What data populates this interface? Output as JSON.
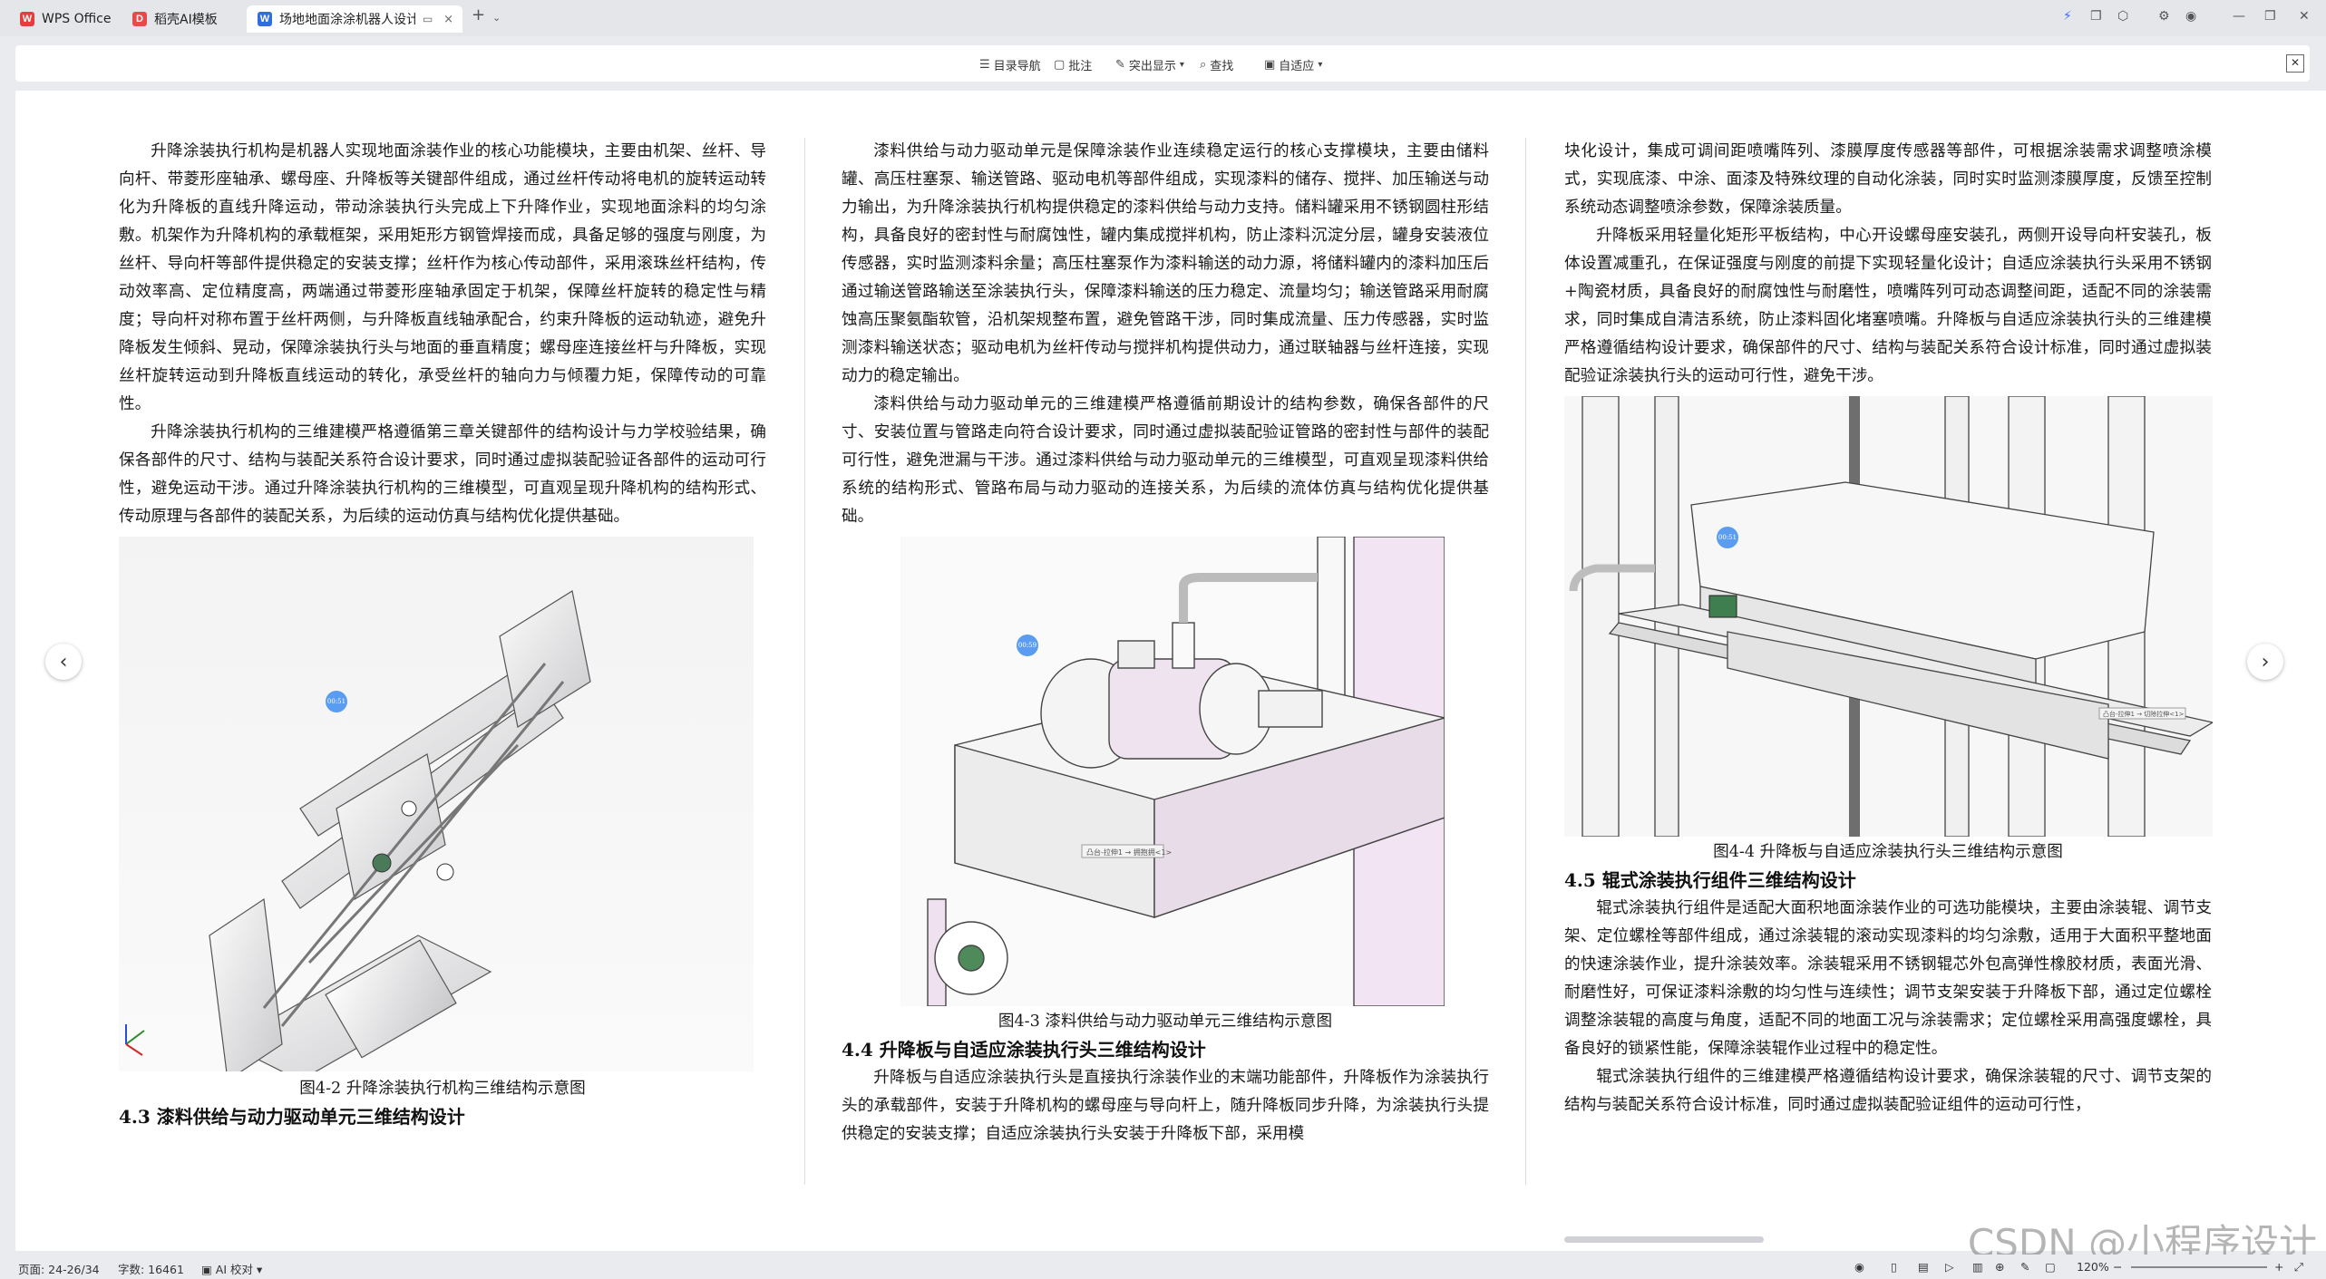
{
  "tabs": [
    {
      "label": "WPS Office",
      "icon": "wps-logo-icon"
    },
    {
      "label": "稻壳AI模板",
      "icon": "docer-logo-icon"
    },
    {
      "label": "场地地面涂涂机器人设计.do",
      "icon": "word-doc-icon"
    }
  ],
  "toolbar": {
    "nav": "目录导航",
    "comment": "批注",
    "highlight": "突出显示",
    "find": "查找",
    "fit": "自适应"
  },
  "doc": {
    "col1": {
      "p1": "升降涂装执行机构是机器人实现地面涂装作业的核心功能模块，主要由机架、丝杆、导向杆、带菱形座轴承、螺母座、升降板等关键部件组成，通过丝杆传动将电机的旋转运动转化为升降板的直线升降运动，带动涂装执行头完成上下升降作业，实现地面涂料的均匀涂敷。机架作为升降机构的承载框架，采用矩形方钢管焊接而成，具备足够的强度与刚度，为丝杆、导向杆等部件提供稳定的安装支撑；丝杆作为核心传动部件，采用滚珠丝杆结构，传动效率高、定位精度高，两端通过带菱形座轴承固定于机架，保障丝杆旋转的稳定性与精度；导向杆对称布置于丝杆两侧，与升降板直线轴承配合，约束升降板的运动轨迹，避免升降板发生倾斜、晃动，保障涂装执行头与地面的垂直精度；螺母座连接丝杆与升降板，实现丝杆旋转运动到升降板直线运动的转化，承受丝杆的轴向力与倾覆力矩，保障传动的可靠性。",
      "p2": "升降涂装执行机构的三维建模严格遵循第三章关键部件的结构设计与力学校验结果，确保各部件的尺寸、结构与装配关系符合设计要求，同时通过虚拟装配验证各部件的运动可行性，避免运动干涉。通过升降涂装执行机构的三维模型，可直观呈现升降机构的结构形式、传动原理与各部件的装配关系，为后续的运动仿真与结构优化提供基础。",
      "fig_caption": "图4-2 升降涂装执行机构三维结构示意图",
      "heading": "4.3 漆料供给与动力驱动单元三维结构设计"
    },
    "col2": {
      "p1": "漆料供给与动力驱动单元是保障涂装作业连续稳定运行的核心支撑模块，主要由储料罐、高压柱塞泵、输送管路、驱动电机等部件组成，实现漆料的储存、搅拌、加压输送与动力输出，为升降涂装执行机构提供稳定的漆料供给与动力支持。储料罐采用不锈钢圆柱形结构，具备良好的密封性与耐腐蚀性，罐内集成搅拌机构，防止漆料沉淀分层，罐身安装液位传感器，实时监测漆料余量；高压柱塞泵作为漆料输送的动力源，将储料罐内的漆料加压后通过输送管路输送至涂装执行头，保障漆料输送的压力稳定、流量均匀；输送管路采用耐腐蚀高压聚氨酯软管，沿机架规整布置，避免管路干涉，同时集成流量、压力传感器，实时监测漆料输送状态；驱动电机为丝杆传动与搅拌机构提供动力，通过联轴器与丝杆连接，实现动力的稳定输出。",
      "p2": "漆料供给与动力驱动单元的三维建模严格遵循前期设计的结构参数，确保各部件的尺寸、安装位置与管路走向符合设计要求，同时通过虚拟装配验证管路的密封性与部件的装配可行性，避免泄漏与干涉。通过漆料供给与动力驱动单元的三维模型，可直观呈现漆料供给系统的结构形式、管路布局与动力驱动的连接关系，为后续的流体仿真与结构优化提供基础。",
      "fig_caption": "图4-3 漆料供给与动力驱动单元三维结构示意图",
      "heading": "4.4 升降板与自适应涂装执行头三维结构设计",
      "p3": "升降板与自适应涂装执行头是直接执行涂装作业的末端功能部件，升降板作为涂装执行头的承载部件，安装于升降机构的螺母座与导向杆上，随升降板同步升降，为涂装执行头提供稳定的安装支撑；自适应涂装执行头安装于升降板下部，采用模"
    },
    "col3": {
      "p1": "块化设计，集成可调间距喷嘴阵列、漆膜厚度传感器等部件，可根据涂装需求调整喷涂模式，实现底漆、中涂、面漆及特殊纹理的自动化涂装，同时实时监测漆膜厚度，反馈至控制系统动态调整喷涂参数，保障涂装质量。",
      "p2": "升降板采用轻量化矩形平板结构，中心开设螺母座安装孔，两侧开设导向杆安装孔，板体设置减重孔，在保证强度与刚度的前提下实现轻量化设计；自适应涂装执行头采用不锈钢+陶瓷材质，具备良好的耐腐蚀性与耐磨性，喷嘴阵列可动态调整间距，适配不同的涂装需求，同时集成自清洁系统，防止漆料固化堵塞喷嘴。升降板与自适应涂装执行头的三维建模严格遵循结构设计要求，确保部件的尺寸、结构与装配关系符合设计标准，同时通过虚拟装配验证涂装执行头的运动可行性，避免干涉。",
      "fig_caption": "图4-4 升降板与自适应涂装执行头三维结构示意图",
      "heading": "4.5 辊式涂装执行组件三维结构设计",
      "p3": "辊式涂装执行组件是适配大面积地面涂装作业的可选功能模块，主要由涂装辊、调节支架、定位螺栓等部件组成，通过涂装辊的滚动实现漆料的均匀涂敷，适用于大面积平整地面的快速涂装作业，提升涂装效率。涂装辊采用不锈钢辊芯外包高弹性橡胶材质，表面光滑、耐磨性好，可保证漆料涂敷的均匀性与连续性；调节支架安装于升降板下部，通过定位螺栓调整涂装辊的高度与角度，适配不同的地面工况与涂装需求；定位螺栓采用高强度螺栓，具备良好的锁紧性能，保障涂装辊作业过程中的稳定性。",
      "p4": "辊式涂装执行组件的三维建模严格遵循结构设计要求，确保涂装辊的尺寸、调节支架的结构与装配关系符合设计标准，同时通过虚拟装配验证组件的运动可行性，"
    },
    "markers": {
      "m1": "00:51",
      "m2": "00:59",
      "m3": "00:51"
    },
    "figlabels": {
      "f3": "凸台-拉伸1 → 拥抱拥<1>",
      "f4": "凸台-拉伸1 → 切除拉伸<1>"
    }
  },
  "status": {
    "page": "页面: 24-26/34",
    "words": "字数: 16461",
    "ai": "AI 校对",
    "zoom": "120%"
  },
  "watermark": "CSDN @小程序设计"
}
